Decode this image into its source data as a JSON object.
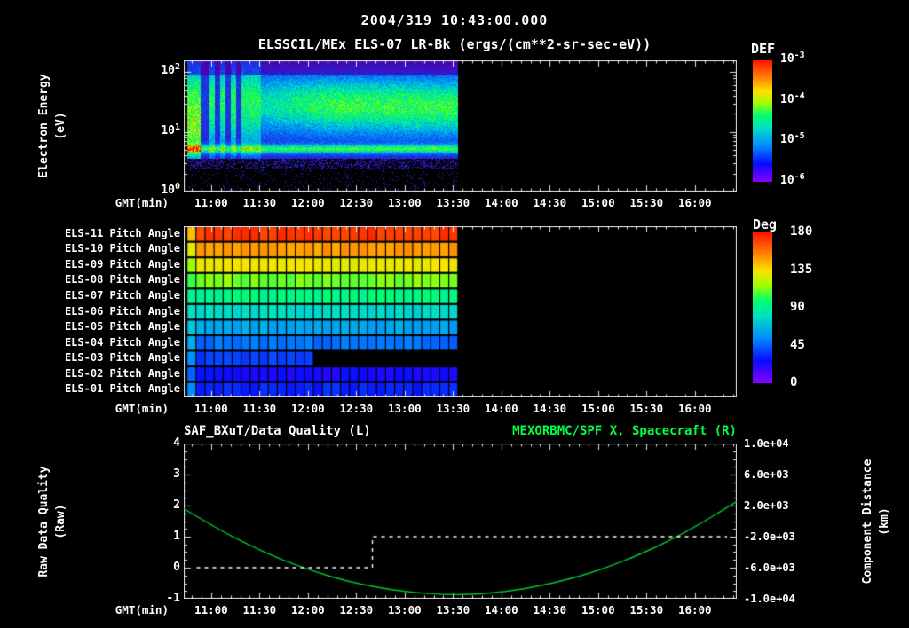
{
  "header": {
    "title": "2004/319 10:43:00.000",
    "subtitle": "ELSSCIL/MEx ELS-07 LR-Bk  (ergs/(cm**2-sr-sec-eV))"
  },
  "colors": {
    "background": "#000000",
    "text": "#ffffff",
    "frame": "#e6e6e6",
    "green_title": "#00ff41",
    "curve_green": "#00c832",
    "quality_white": "#ffffff"
  },
  "time_axis": {
    "label": "GMT(min)",
    "start_min": 643,
    "end_min": 986,
    "tick_labels": [
      "11:00",
      "11:30",
      "12:00",
      "12:30",
      "13:00",
      "13:30",
      "14:00",
      "14:30",
      "15:00",
      "15:30",
      "16:00"
    ],
    "tick_minutes": [
      660,
      690,
      720,
      750,
      780,
      810,
      840,
      870,
      900,
      930,
      960
    ],
    "minor_step_min": 6
  },
  "chart_data": [
    {
      "id": "energy_spectrogram",
      "type": "heatmap",
      "title": "ELSSCIL/MEx ELS-07 LR-Bk",
      "units": "ergs/(cm**2-sr-sec-eV)",
      "ylabel_lines": [
        "Electron Energy",
        "(eV)"
      ],
      "xlabel": "GMT(min)",
      "y_scale": "log",
      "y_range_ev": [
        1,
        158
      ],
      "log_top": 2.2,
      "y_ticks": [
        {
          "base": "10",
          "exp": "2",
          "log": 2
        },
        {
          "base": "10",
          "exp": "1",
          "log": 1
        },
        {
          "base": "10",
          "exp": "0",
          "log": 0
        }
      ],
      "data_start_min": 645,
      "data_end_min": 813,
      "colorbar": {
        "title": "DEF",
        "scale": "log",
        "ticks": [
          {
            "base": "10",
            "exp": "-3"
          },
          {
            "base": "10",
            "exp": "-4"
          },
          {
            "base": "10",
            "exp": "-5"
          },
          {
            "base": "10",
            "exp": "-6"
          }
        ]
      },
      "features": {
        "background_level": 0.17,
        "band": {
          "center_log_ev": 1.5,
          "center_drift": -0.08,
          "width_log": 0.34,
          "amp_early": 0.33,
          "amp_late": 0.46
        },
        "photoelectron_line": {
          "center_log_ev": 0.72,
          "width_log": 0.05,
          "amp": 0.42
        },
        "early_end_frac": 0.27,
        "early_stripes": [
          [
            0.0,
            0.05
          ],
          [
            0.08,
            0.1
          ],
          [
            0.12,
            0.14
          ],
          [
            0.16,
            0.18
          ],
          [
            0.2,
            0.27
          ]
        ],
        "speckle_below_log_ev": 0.55,
        "speckle_prob_high": 0.35,
        "speckle_prob_low": 0.06
      }
    },
    {
      "id": "pitch_angle",
      "type": "heatmap",
      "xlabel": "GMT(min)",
      "data_start_min": 645,
      "data_end_min": 813,
      "n_cells": 30,
      "rows": [
        {
          "label": "ELS-11 Pitch Angle",
          "value_deg": 172
        },
        {
          "label": "ELS-10 Pitch Angle",
          "value_deg": 150
        },
        {
          "label": "ELS-09 Pitch Angle",
          "value_deg": 132
        },
        {
          "label": "ELS-08 Pitch Angle",
          "value_deg": 112
        },
        {
          "label": "ELS-07 Pitch Angle",
          "value_deg": 95
        },
        {
          "label": "ELS-06 Pitch Angle",
          "value_deg": 78
        },
        {
          "label": "ELS-05 Pitch Angle",
          "value_deg": 62
        },
        {
          "label": "ELS-04 Pitch Angle",
          "value_deg": 48
        },
        {
          "label": "ELS-03 Pitch Angle",
          "value_deg": 38,
          "gap_start_min": 725
        },
        {
          "label": "ELS-02 Pitch Angle",
          "value_deg": 25
        },
        {
          "label": "ELS-01 Pitch Angle",
          "value_deg": 32
        }
      ],
      "colorbar": {
        "title": "Deg",
        "range_deg": [
          0,
          180
        ],
        "ticks": [
          180,
          135,
          90,
          45,
          0
        ]
      }
    },
    {
      "id": "quality_distance",
      "type": "line",
      "title_left": "SAF_BXuT/Data Quality (L)",
      "title_right": "MEXORBMC/SPF X, Spacecraft (R)",
      "ylabel_left_lines": [
        "Raw Data Quality",
        "(Raw)"
      ],
      "ylabel_right_lines": [
        "Component Distance",
        "(km)"
      ],
      "xlabel": "GMT(min)",
      "y_left_range": [
        -1,
        4
      ],
      "y_left_ticks": [
        4,
        3,
        2,
        1,
        0,
        -1
      ],
      "y_right_ticks": [
        "1.0e+04",
        "6.0e+03",
        "2.0e+03",
        "-2.0e+03",
        "-6.0e+03",
        "-1.0e+04"
      ],
      "series": [
        {
          "name": "spacecraft_x_component_distance",
          "color": "#00c832",
          "style": "solid",
          "t_min": [
            643,
            663,
            683,
            703,
            723,
            743,
            763,
            783,
            803,
            811,
            823,
            843,
            863,
            883,
            903,
            923,
            943,
            963,
            983,
            986
          ],
          "y_left": [
            1.9,
            1.28,
            0.74,
            0.27,
            -0.11,
            -0.42,
            -0.64,
            -0.79,
            -0.86,
            -0.87,
            -0.86,
            -0.77,
            -0.6,
            -0.36,
            -0.04,
            0.36,
            0.84,
            1.4,
            2.03,
            2.13
          ]
        },
        {
          "name": "raw_data_quality",
          "color": "#ffffff",
          "style": "dashed",
          "t_min": [
            651,
            760,
            760,
            980
          ],
          "y_left": [
            0,
            0,
            1,
            1
          ]
        }
      ]
    }
  ]
}
